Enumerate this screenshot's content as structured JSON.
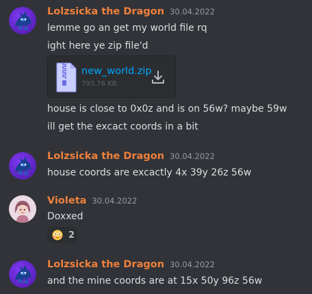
{
  "messages": [
    {
      "author": "Lolzsicka the Dragon",
      "timestamp": "30.04.2022",
      "lines": [
        "lemme go an get my world file rq",
        "ight here ye zip file'd"
      ],
      "attachment": {
        "name": "new_world.zip",
        "size": "793.76 KB"
      },
      "after_lines": [
        "house is close to 0x0z and is on 56w? maybe 59w",
        "ill get the excact coords in a bit"
      ]
    },
    {
      "author": "Lolzsicka the Dragon",
      "timestamp": "30.04.2022",
      "lines": [
        "house coords are excactly 4x 39y 26z 56w"
      ]
    },
    {
      "author": "Violeta",
      "timestamp": "30.04.2022",
      "lines": [
        "Doxxed"
      ],
      "reaction": {
        "emoji": "flushed-face",
        "count": "2"
      }
    },
    {
      "author": "Lolzsicka the Dragon",
      "timestamp": "30.04.2022",
      "lines": [
        "and the mine coords are at 15x 50y 96z 56w"
      ]
    }
  ],
  "colors": {
    "background": "#313338",
    "username": "#f0803c",
    "text": "#dbdee1",
    "link": "#00a8fc",
    "dragon_avatar_bg": "#6d28d9"
  }
}
